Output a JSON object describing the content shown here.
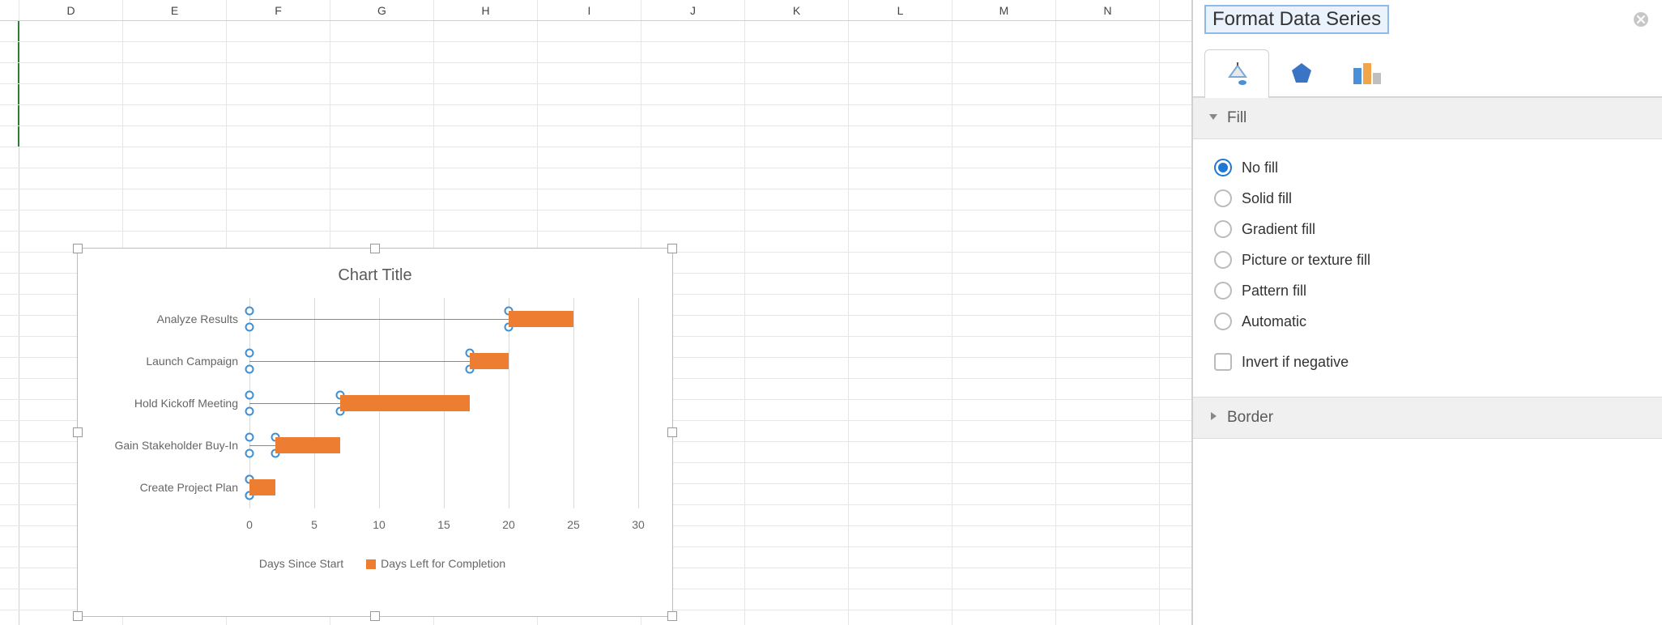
{
  "columns": [
    "D",
    "E",
    "F",
    "G",
    "H",
    "I",
    "J",
    "K",
    "L",
    "M",
    "N"
  ],
  "sidebar": {
    "title": "Format Data Series",
    "sections": {
      "fill": {
        "label": "Fill",
        "expanded": true,
        "options": [
          {
            "label": "No fill",
            "checked": true
          },
          {
            "label": "Solid fill",
            "checked": false
          },
          {
            "label": "Gradient fill",
            "checked": false
          },
          {
            "label": "Picture or texture fill",
            "checked": false
          },
          {
            "label": "Pattern fill",
            "checked": false
          },
          {
            "label": "Automatic",
            "checked": false
          }
        ],
        "invert_label": "Invert if negative",
        "invert_checked": false
      },
      "border": {
        "label": "Border",
        "expanded": false
      }
    }
  },
  "chart_data": {
    "type": "bar",
    "title": "Chart Title",
    "xlabel": "",
    "ylabel": "",
    "xlim": [
      0,
      30
    ],
    "x_ticks": [
      0,
      5,
      10,
      15,
      20,
      25,
      30
    ],
    "categories": [
      "Analyze Results",
      "Launch Campaign",
      "Hold Kickoff Meeting",
      "Gain Stakeholder Buy-In",
      "Create Project Plan"
    ],
    "series": [
      {
        "name": "Days Since Start",
        "values": [
          20,
          17,
          7,
          2,
          0
        ],
        "color": "transparent"
      },
      {
        "name": "Days Left for Completion",
        "values": [
          5,
          3,
          10,
          5,
          2
        ],
        "color": "#ed7d31"
      }
    ],
    "legend_position": "bottom",
    "selected_series_index": 0
  }
}
